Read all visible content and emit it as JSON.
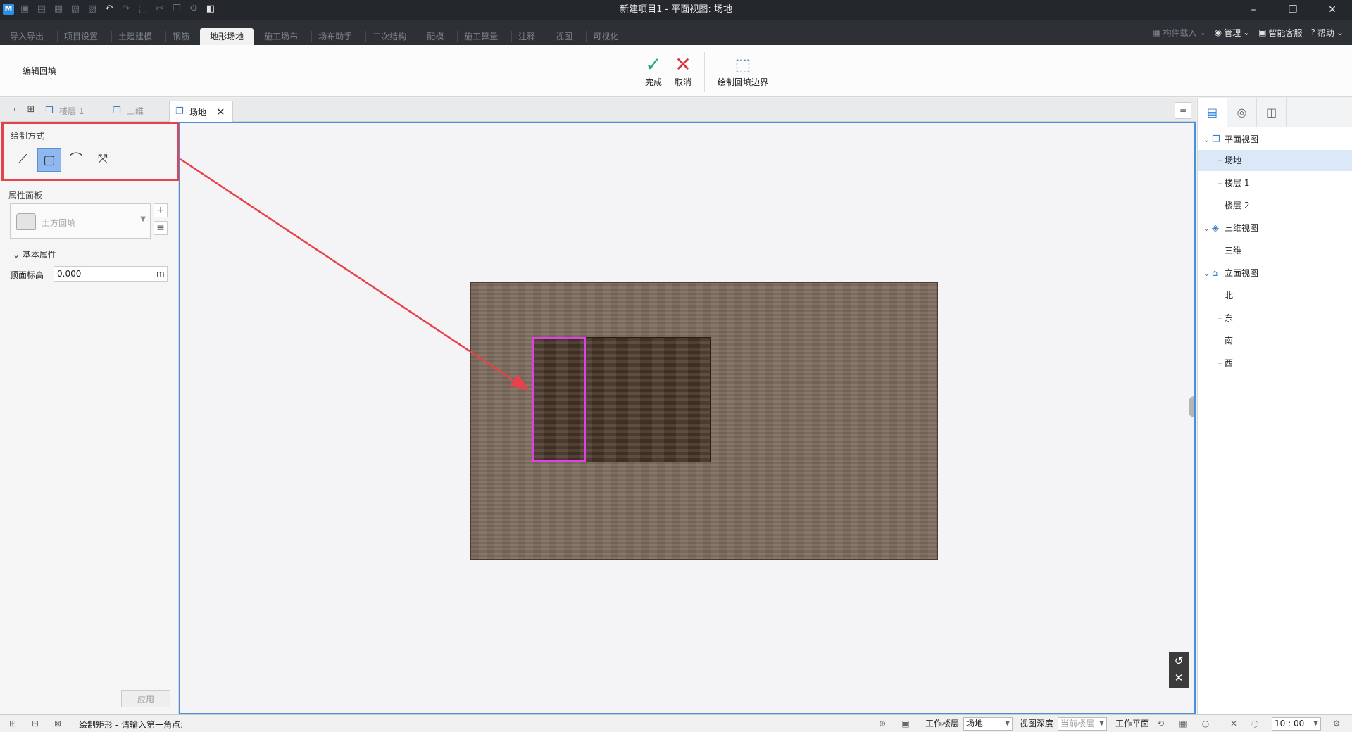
{
  "titlebar": {
    "title": "新建项目1 - 平面视图: 场地",
    "logo": "M",
    "window_controls": {
      "minimize": "–",
      "restore": "❐",
      "close": "✕"
    }
  },
  "ribbon": {
    "tabs": [
      "导入导出",
      "项目设置",
      "土建建模",
      "钢筋",
      "地形场地",
      "施工场布",
      "场布助手",
      "二次结构",
      "配模",
      "施工算量",
      "注释",
      "视图",
      "可视化"
    ],
    "active_tab": "地形场地",
    "right": {
      "component_load": "构件载入",
      "manage": "管理",
      "smart_service": "智能客服",
      "help": "帮助"
    }
  },
  "toolbar": {
    "title": "编辑回填",
    "finish": "完成",
    "cancel": "取消",
    "draw_boundary": "绘制回填边界"
  },
  "docbar": {
    "tabs": [
      "楼层 1",
      "三维",
      "场地"
    ],
    "active": "场地",
    "close": "✕",
    "menu": "≡"
  },
  "left_panel": {
    "draw_mode_label": "绘制方式",
    "draw_tools": [
      "line",
      "rectangle",
      "arc",
      "pick"
    ],
    "active_tool": "rectangle",
    "properties_label": "属性面板",
    "type_name": "土方回填",
    "add": "+",
    "list": "≡",
    "basic_props_label": "基本属性",
    "top_elevation_label": "顶面标高",
    "top_elevation_value": "0.000",
    "unit": "m",
    "apply": "应用"
  },
  "canvas": {
    "view_reset": "↺",
    "view_close": "✕"
  },
  "right_panel": {
    "groups": [
      {
        "label": "平面视图",
        "children": [
          "场地",
          "楼层 1",
          "楼层 2"
        ]
      },
      {
        "label": "三维视图",
        "children": [
          "三维"
        ]
      },
      {
        "label": "立面视图",
        "children": [
          "北",
          "东",
          "南",
          "西"
        ]
      }
    ],
    "selected": "场地"
  },
  "statusbar": {
    "message": "绘制矩形 - 请输入第一角点:",
    "work_floor_label": "工作楼层",
    "work_floor_value": "场地",
    "view_depth_label": "视图深度",
    "view_depth_value": "当前楼层",
    "work_plane_label": "工作平面",
    "time_value": "10 : 00"
  },
  "colors": {
    "accent": "#4a8ee0",
    "highlight_box": "#e84149",
    "selection": "#e040e8",
    "finish": "#2aa58a",
    "cancel": "#d9333f"
  }
}
